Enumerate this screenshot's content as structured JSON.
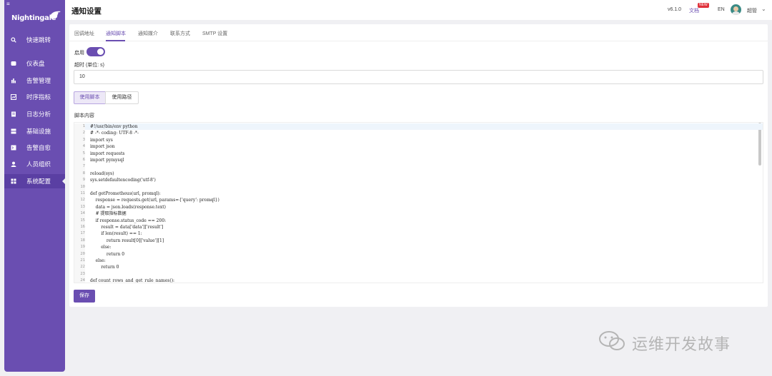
{
  "app": {
    "logo_text": "Nightingale"
  },
  "header": {
    "title": "通知设置",
    "version": "v6.1.0",
    "docs_label": "文档",
    "new_badge": "NEW",
    "lang": "EN",
    "username": "超管"
  },
  "sidebar": {
    "items": [
      {
        "label": "快速跳转",
        "icon": "search-icon"
      },
      {
        "label": "仪表盘",
        "icon": "dashboard-icon"
      },
      {
        "label": "告警管理",
        "icon": "alert-icon"
      },
      {
        "label": "时序指标",
        "icon": "chart-icon"
      },
      {
        "label": "日志分析",
        "icon": "log-icon"
      },
      {
        "label": "基础设施",
        "icon": "server-icon"
      },
      {
        "label": "告警自愈",
        "icon": "terminal-icon"
      },
      {
        "label": "人员组织",
        "icon": "user-icon"
      },
      {
        "label": "系统配置",
        "icon": "grid-icon"
      }
    ]
  },
  "tabs": [
    "回调地址",
    "通知脚本",
    "通知媒介",
    "联系方式",
    "SMTP 设置"
  ],
  "form": {
    "enable_label": "启用",
    "enabled": true,
    "timeout_label": "超时 (单位: s)",
    "timeout_value": "10",
    "mode_script": "使用脚本",
    "mode_path": "使用路径",
    "script_label": "脚本内容",
    "save_label": "保存"
  },
  "editor": {
    "lines": [
      "#!/usr/bin/env python",
      "# -*- coding: UTF-8 -*-",
      "import sys",
      "import json",
      "import requests",
      "import pymysql",
      "",
      "reload(sys)",
      "sys.setdefaultencoding('utf-8')",
      "",
      "def getPrometheus(url, promql):",
      "    response = requests.get(url, params={'query': promql})",
      "    data = json.loads(response.text)",
      "    # 提取指标数据",
      "    if response.status_code == 200:",
      "        result = data['data']['result']",
      "        if len(result) == 1:",
      "            return result[0]['value'][1]",
      "        else:",
      "            return 0",
      "    else:",
      "        return 0",
      "",
      "def count_rows_and_get_rule_names():"
    ]
  },
  "watermark": "运维开发故事",
  "colors": {
    "brand": "#6a4eb1",
    "badge": "#e0313a"
  }
}
